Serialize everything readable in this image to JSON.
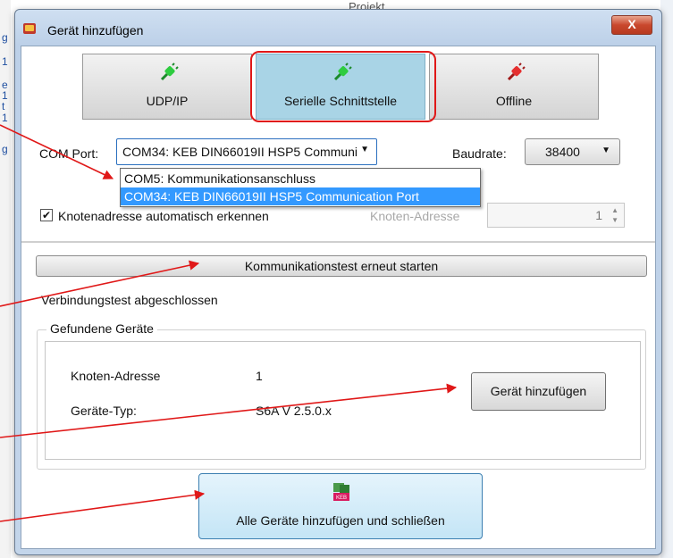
{
  "background": {
    "top_text": "Projekt",
    "left_letters": [
      "g",
      "1",
      "e",
      "1",
      "t",
      "1",
      "g"
    ]
  },
  "dialog": {
    "title": "Gerät hinzufügen",
    "close_label": "X",
    "modes": [
      {
        "label": "UDP/IP",
        "icon": "plug-green-icon",
        "active": false
      },
      {
        "label": "Serielle Schnittstelle",
        "icon": "plug-green-icon",
        "active": true
      },
      {
        "label": "Offline",
        "icon": "plug-red-icon",
        "active": false
      }
    ],
    "com_port": {
      "label": "COM Port:",
      "value": "COM34: KEB DIN66019II HSP5 Communication Port",
      "options": [
        "COM5: Kommunikationsanschluss",
        "COM34: KEB DIN66019II HSP5 Communication Port"
      ]
    },
    "baudrate": {
      "label": "Baudrate:",
      "value": "38400"
    },
    "auto_detect": {
      "checked": true,
      "label": "Knotenadresse automatisch erkennen"
    },
    "node_address": {
      "label": "Knoten-Adresse",
      "value": "1"
    },
    "restart_label": "Kommunikationstest erneut starten",
    "status": "Verbindungstest abgeschlossen",
    "found_group": {
      "title": "Gefundene Geräte",
      "node_key": "Knoten-Adresse",
      "node_value": "1",
      "type_key": "Geräte-Typ:",
      "type_value": "S6A V 2.5.0.x",
      "add_label": "Gerät hinzufügen"
    },
    "add_all_label": "Alle Geräte hinzufügen und schließen",
    "add_all_icon_text": "KEB"
  },
  "colors": {
    "highlight": "#e01818",
    "selection": "#3399ff",
    "active_tab": "#a9d4e6"
  }
}
